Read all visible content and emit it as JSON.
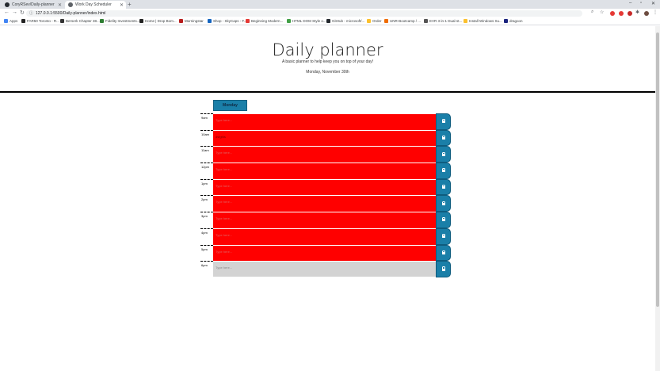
{
  "browser": {
    "tabs": [
      {
        "title": "CoryRSev/Daily-planner"
      },
      {
        "title": "Work Day Scheduler"
      }
    ],
    "url": "127.0.0.1:5500/Daily-planner/index.html",
    "bookmarks": [
      "Apps",
      "FAR50 Toronto - R...",
      "Berserk Chapter 38...",
      "Fidelity Investments...",
      "Home | Drop Bom...",
      "Morningstar",
      "Shop - SkyCaps - F...",
      "Beginning Modern...",
      "HTML DOM Style o...",
      "GitHub - microsoft/...",
      "Order",
      "UNR-Bootcamp / ...",
      "EVR 3-in-1 Dual-st...",
      "Install Windows Su...",
      "dragoon"
    ]
  },
  "header": {
    "title": "Daily planner",
    "lead": "A basic planner to help keep you on top of your day!",
    "current_day": "Monday, November 30th"
  },
  "day_tab": "Monday",
  "rows": [
    {
      "hour": "9am",
      "text": "",
      "placeholder": "Type here...",
      "state": "past"
    },
    {
      "hour": "10am",
      "text": "dsfgfds",
      "placeholder": "Type here...",
      "state": "past"
    },
    {
      "hour": "11am",
      "text": "",
      "placeholder": "Type here...",
      "state": "past"
    },
    {
      "hour": "12pm",
      "text": "",
      "placeholder": "Type here...",
      "state": "past"
    },
    {
      "hour": "1pm",
      "text": "",
      "placeholder": "Type here...",
      "state": "past"
    },
    {
      "hour": "2pm",
      "text": "",
      "placeholder": "Type here...",
      "state": "past"
    },
    {
      "hour": "3pm",
      "text": "",
      "placeholder": "Type here...",
      "state": "past"
    },
    {
      "hour": "4pm",
      "text": "",
      "placeholder": "Type here...",
      "state": "past"
    },
    {
      "hour": "5pm",
      "text": "",
      "placeholder": "Type here...",
      "state": "past"
    },
    {
      "hour": "6pm",
      "text": "",
      "placeholder": "Type here...",
      "state": "future"
    }
  ],
  "colors": {
    "past": "#ff0000",
    "future": "#d3d3d3",
    "save_button": "#1a7fa8"
  },
  "icons": {
    "save": "lock-icon"
  }
}
